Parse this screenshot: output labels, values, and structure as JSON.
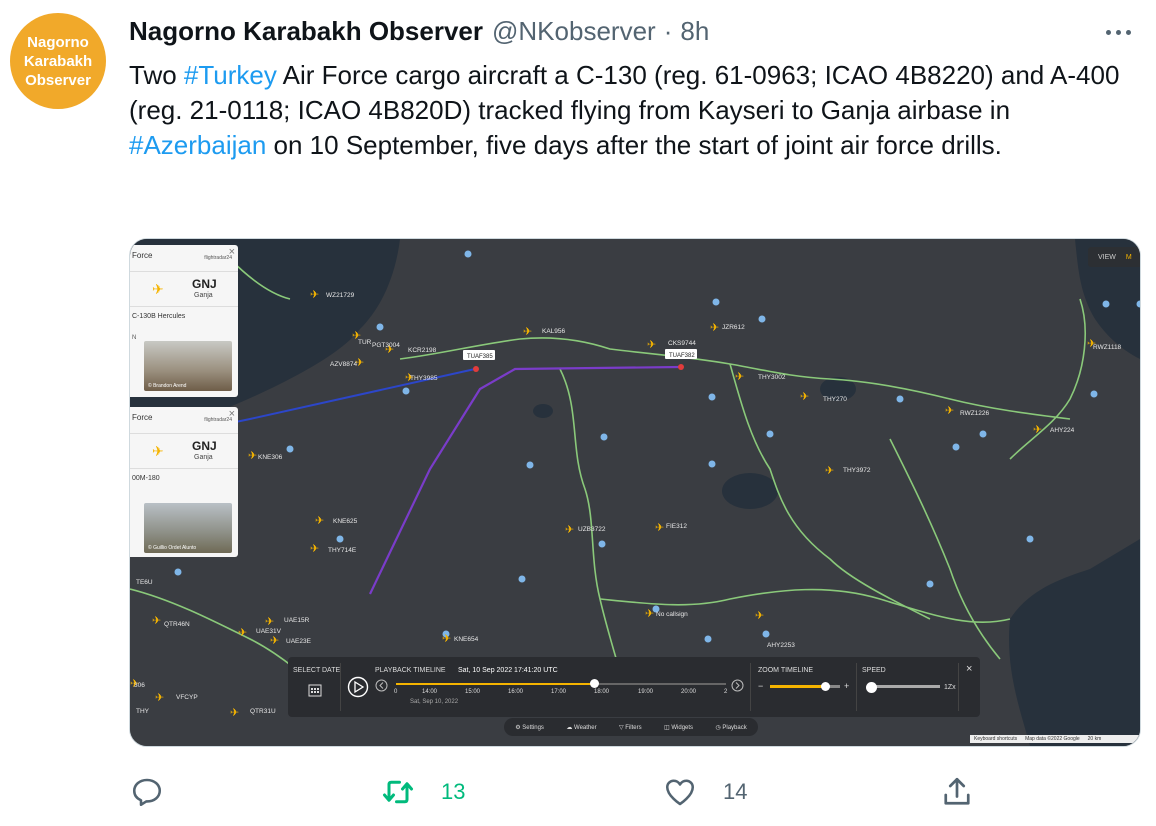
{
  "author": {
    "avatar_lines": [
      "Nagorno",
      "Karabakh",
      "Observer"
    ],
    "name": "Nagorno Karabakh Observer",
    "handle": "@NKobserver",
    "separator": "·",
    "time": "8h"
  },
  "tweet": {
    "segments": [
      {
        "text": "Two ",
        "type": "plain"
      },
      {
        "text": "#Turkey",
        "type": "hashtag"
      },
      {
        "text": " Air Force cargo aircraft a C-130 (reg. 61-0963; ICAO 4B8220) and A-400 (reg. 21-0118; ICAO 4B820D) tracked flying from Kayseri to Ganja airbase in ",
        "type": "plain"
      },
      {
        "text": "#Azerbaijan",
        "type": "hashtag"
      },
      {
        "text": " on 10 September, five days after the start of joint air force drills.",
        "type": "plain"
      }
    ]
  },
  "media": {
    "view_label": "VIEW",
    "view_mode": "M",
    "cards": [
      {
        "title": "Force",
        "brand": "flightradar24",
        "dest_code": "GNJ",
        "dest_city": "Ganja",
        "model": "C-130B Hercules",
        "side_letter": "N",
        "photo_credit": "© Brandon Arend"
      },
      {
        "title": "Force",
        "brand": "flightradar24",
        "dest_code": "GNJ",
        "dest_city": "Ganja",
        "model": "00M-180",
        "side_letter": "",
        "photo_credit": "© Guillio Ordet Alunto"
      }
    ],
    "callouts": [
      "TUAF385",
      "TUAF382"
    ],
    "flight_labels": [
      "WZ21729",
      "TUR",
      "PGT3004",
      "KCR2198",
      "AZV8874",
      "THY3985",
      "KAL956",
      "CKS9744",
      "JZR612",
      "THY3002",
      "THY270",
      "RWZ1226",
      "AHY224",
      "RWZ1118",
      "THY3972",
      "KNE306",
      "KNE625",
      "THY714E",
      "UZB3722",
      "FIE312",
      "No callsign",
      "AHY2253",
      "KNE654",
      "UAE15R",
      "UAE31V",
      "UAE23E",
      "QTR46N",
      "TE6U",
      "VFCYP",
      "THY",
      "QTR31U",
      "306"
    ],
    "controls": {
      "select_date": [
        "SELECT",
        "DATE"
      ],
      "playback_label": "PLAYBACK TIMELINE",
      "timestamp": "Sat, 10 Sep 2022 17:41:20 UTC",
      "ticks": [
        "0",
        "14:00",
        "15:00",
        "16:00",
        "17:00",
        "18:00",
        "19:00",
        "20:00",
        "2"
      ],
      "date_sub": "Sat, Sep 10, 2022",
      "playback_progress": 0.6,
      "zoom_label": "ZOOM TIMELINE",
      "zoom_level": 0.78,
      "speed_label": "SPEED",
      "speed_value": "1Zx",
      "speed_level": 0.0
    },
    "tools": [
      "Settings",
      "Weather",
      "Filters",
      "Widgets",
      "Playback"
    ],
    "attribution": [
      "Keyboard shortcuts",
      "Map data ©2022 Google",
      "20 km"
    ],
    "colors": {
      "map_bg": "#3a3d42",
      "sea": "#27313c",
      "border": "#8ac97a",
      "track_blue": "#2c46c9",
      "track_purple": "#7a3cc9",
      "plane": "#f5b400"
    }
  },
  "actions": {
    "reply_count": "",
    "retweet_count": "13",
    "like_count": "14"
  },
  "colors": {
    "link": "#1d9bf0",
    "muted": "#536471",
    "retweet": "#00ba7c",
    "avatar": "#f1a92a"
  }
}
